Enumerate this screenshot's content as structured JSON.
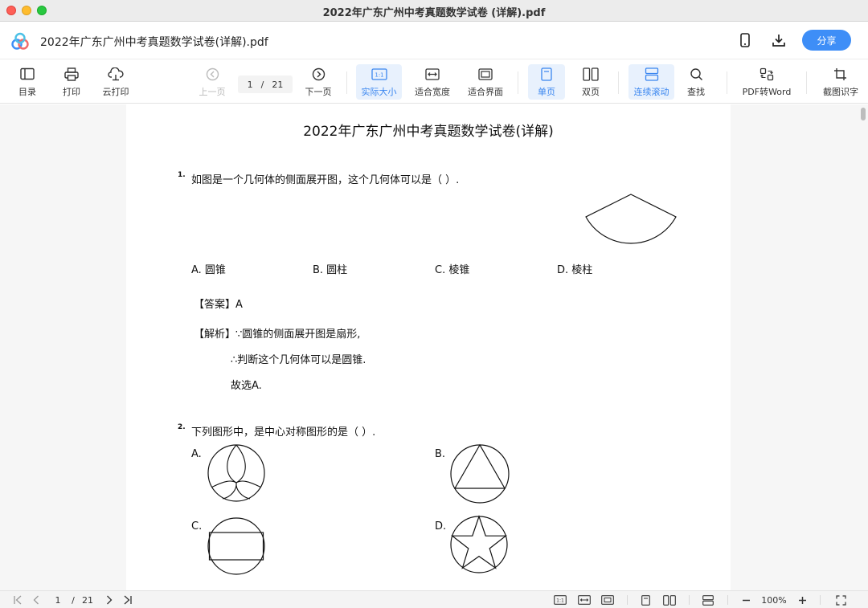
{
  "window": {
    "title": "2022年广东广州中考真题数学试卷 (详解).pdf"
  },
  "header": {
    "file_name": "2022年广东广州中考真题数学试卷(详解).pdf",
    "share_label": "分享",
    "icons": [
      "app-logo",
      "phone-icon",
      "download-icon"
    ]
  },
  "toolbar": {
    "toc": "目录",
    "print": "打印",
    "cloud_print": "云打印",
    "prev_page": "上一页",
    "current_page": "1",
    "page_sep": "/",
    "total_pages": "21",
    "next_page": "下一页",
    "actual_size": "实际大小",
    "actual_size_glyph": "1:1",
    "fit_width": "适合宽度",
    "fit_page": "适合界面",
    "single_page": "单页",
    "double_page": "双页",
    "continuous_scroll": "连续滚动",
    "find": "查找",
    "pdf_to_word": "PDF转Word",
    "ocr": "截图识字"
  },
  "document": {
    "title": "2022年广东广州中考真题数学试卷(详解)",
    "q1": {
      "num": "1.",
      "text": "如图是一个几何体的侧面展开图，这个几何体可以是（   ）.",
      "options": [
        "A. 圆锥",
        "B. 圆柱",
        "C. 棱锥",
        "D. 棱柱"
      ],
      "answer_label": "【答案】",
      "answer": "A",
      "analysis_label": "【解析】",
      "analysis": [
        "∵圆锥的侧面展开图是扇形,",
        "∴判断这个几何体可以是圆锥.",
        "故选A."
      ]
    },
    "q2": {
      "num": "2.",
      "text": "下列图形中，是中心对称图形的是（   ）.",
      "options": [
        "A.",
        "B.",
        "C.",
        "D."
      ]
    }
  },
  "statusbar": {
    "current_page": "1",
    "page_sep": "/",
    "total_pages": "21",
    "zoom": "100%",
    "actual_size_glyph": "1:1"
  },
  "colors": {
    "accent": "#3e8ef7",
    "active_bg": "#e8f1fd",
    "page_bg": "#f6f6f6"
  }
}
